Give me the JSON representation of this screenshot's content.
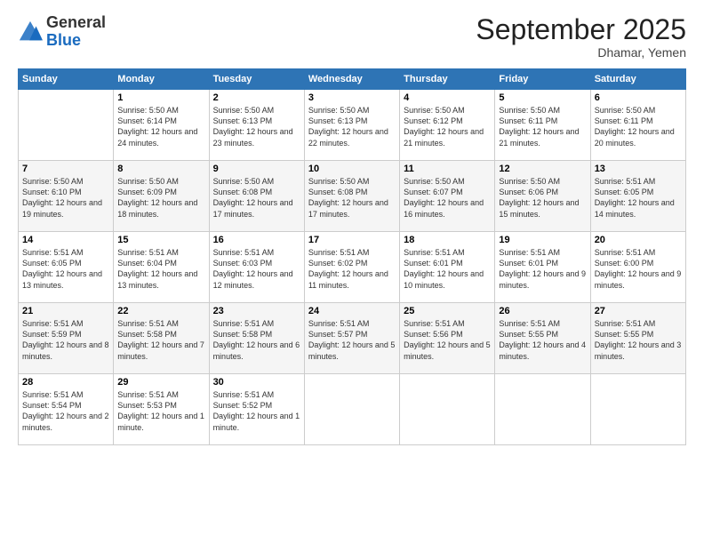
{
  "logo": {
    "general": "General",
    "blue": "Blue"
  },
  "header": {
    "month": "September 2025",
    "location": "Dhamar, Yemen"
  },
  "days_of_week": [
    "Sunday",
    "Monday",
    "Tuesday",
    "Wednesday",
    "Thursday",
    "Friday",
    "Saturday"
  ],
  "weeks": [
    [
      {
        "day": "",
        "sunrise": "",
        "sunset": "",
        "daylight": ""
      },
      {
        "day": "1",
        "sunrise": "Sunrise: 5:50 AM",
        "sunset": "Sunset: 6:14 PM",
        "daylight": "Daylight: 12 hours and 24 minutes."
      },
      {
        "day": "2",
        "sunrise": "Sunrise: 5:50 AM",
        "sunset": "Sunset: 6:13 PM",
        "daylight": "Daylight: 12 hours and 23 minutes."
      },
      {
        "day": "3",
        "sunrise": "Sunrise: 5:50 AM",
        "sunset": "Sunset: 6:13 PM",
        "daylight": "Daylight: 12 hours and 22 minutes."
      },
      {
        "day": "4",
        "sunrise": "Sunrise: 5:50 AM",
        "sunset": "Sunset: 6:12 PM",
        "daylight": "Daylight: 12 hours and 21 minutes."
      },
      {
        "day": "5",
        "sunrise": "Sunrise: 5:50 AM",
        "sunset": "Sunset: 6:11 PM",
        "daylight": "Daylight: 12 hours and 21 minutes."
      },
      {
        "day": "6",
        "sunrise": "Sunrise: 5:50 AM",
        "sunset": "Sunset: 6:11 PM",
        "daylight": "Daylight: 12 hours and 20 minutes."
      }
    ],
    [
      {
        "day": "7",
        "sunrise": "Sunrise: 5:50 AM",
        "sunset": "Sunset: 6:10 PM",
        "daylight": "Daylight: 12 hours and 19 minutes."
      },
      {
        "day": "8",
        "sunrise": "Sunrise: 5:50 AM",
        "sunset": "Sunset: 6:09 PM",
        "daylight": "Daylight: 12 hours and 18 minutes."
      },
      {
        "day": "9",
        "sunrise": "Sunrise: 5:50 AM",
        "sunset": "Sunset: 6:08 PM",
        "daylight": "Daylight: 12 hours and 17 minutes."
      },
      {
        "day": "10",
        "sunrise": "Sunrise: 5:50 AM",
        "sunset": "Sunset: 6:08 PM",
        "daylight": "Daylight: 12 hours and 17 minutes."
      },
      {
        "day": "11",
        "sunrise": "Sunrise: 5:50 AM",
        "sunset": "Sunset: 6:07 PM",
        "daylight": "Daylight: 12 hours and 16 minutes."
      },
      {
        "day": "12",
        "sunrise": "Sunrise: 5:50 AM",
        "sunset": "Sunset: 6:06 PM",
        "daylight": "Daylight: 12 hours and 15 minutes."
      },
      {
        "day": "13",
        "sunrise": "Sunrise: 5:51 AM",
        "sunset": "Sunset: 6:05 PM",
        "daylight": "Daylight: 12 hours and 14 minutes."
      }
    ],
    [
      {
        "day": "14",
        "sunrise": "Sunrise: 5:51 AM",
        "sunset": "Sunset: 6:05 PM",
        "daylight": "Daylight: 12 hours and 13 minutes."
      },
      {
        "day": "15",
        "sunrise": "Sunrise: 5:51 AM",
        "sunset": "Sunset: 6:04 PM",
        "daylight": "Daylight: 12 hours and 13 minutes."
      },
      {
        "day": "16",
        "sunrise": "Sunrise: 5:51 AM",
        "sunset": "Sunset: 6:03 PM",
        "daylight": "Daylight: 12 hours and 12 minutes."
      },
      {
        "day": "17",
        "sunrise": "Sunrise: 5:51 AM",
        "sunset": "Sunset: 6:02 PM",
        "daylight": "Daylight: 12 hours and 11 minutes."
      },
      {
        "day": "18",
        "sunrise": "Sunrise: 5:51 AM",
        "sunset": "Sunset: 6:01 PM",
        "daylight": "Daylight: 12 hours and 10 minutes."
      },
      {
        "day": "19",
        "sunrise": "Sunrise: 5:51 AM",
        "sunset": "Sunset: 6:01 PM",
        "daylight": "Daylight: 12 hours and 9 minutes."
      },
      {
        "day": "20",
        "sunrise": "Sunrise: 5:51 AM",
        "sunset": "Sunset: 6:00 PM",
        "daylight": "Daylight: 12 hours and 9 minutes."
      }
    ],
    [
      {
        "day": "21",
        "sunrise": "Sunrise: 5:51 AM",
        "sunset": "Sunset: 5:59 PM",
        "daylight": "Daylight: 12 hours and 8 minutes."
      },
      {
        "day": "22",
        "sunrise": "Sunrise: 5:51 AM",
        "sunset": "Sunset: 5:58 PM",
        "daylight": "Daylight: 12 hours and 7 minutes."
      },
      {
        "day": "23",
        "sunrise": "Sunrise: 5:51 AM",
        "sunset": "Sunset: 5:58 PM",
        "daylight": "Daylight: 12 hours and 6 minutes."
      },
      {
        "day": "24",
        "sunrise": "Sunrise: 5:51 AM",
        "sunset": "Sunset: 5:57 PM",
        "daylight": "Daylight: 12 hours and 5 minutes."
      },
      {
        "day": "25",
        "sunrise": "Sunrise: 5:51 AM",
        "sunset": "Sunset: 5:56 PM",
        "daylight": "Daylight: 12 hours and 5 minutes."
      },
      {
        "day": "26",
        "sunrise": "Sunrise: 5:51 AM",
        "sunset": "Sunset: 5:55 PM",
        "daylight": "Daylight: 12 hours and 4 minutes."
      },
      {
        "day": "27",
        "sunrise": "Sunrise: 5:51 AM",
        "sunset": "Sunset: 5:55 PM",
        "daylight": "Daylight: 12 hours and 3 minutes."
      }
    ],
    [
      {
        "day": "28",
        "sunrise": "Sunrise: 5:51 AM",
        "sunset": "Sunset: 5:54 PM",
        "daylight": "Daylight: 12 hours and 2 minutes."
      },
      {
        "day": "29",
        "sunrise": "Sunrise: 5:51 AM",
        "sunset": "Sunset: 5:53 PM",
        "daylight": "Daylight: 12 hours and 1 minute."
      },
      {
        "day": "30",
        "sunrise": "Sunrise: 5:51 AM",
        "sunset": "Sunset: 5:52 PM",
        "daylight": "Daylight: 12 hours and 1 minute."
      },
      {
        "day": "",
        "sunrise": "",
        "sunset": "",
        "daylight": ""
      },
      {
        "day": "",
        "sunrise": "",
        "sunset": "",
        "daylight": ""
      },
      {
        "day": "",
        "sunrise": "",
        "sunset": "",
        "daylight": ""
      },
      {
        "day": "",
        "sunrise": "",
        "sunset": "",
        "daylight": ""
      }
    ]
  ]
}
